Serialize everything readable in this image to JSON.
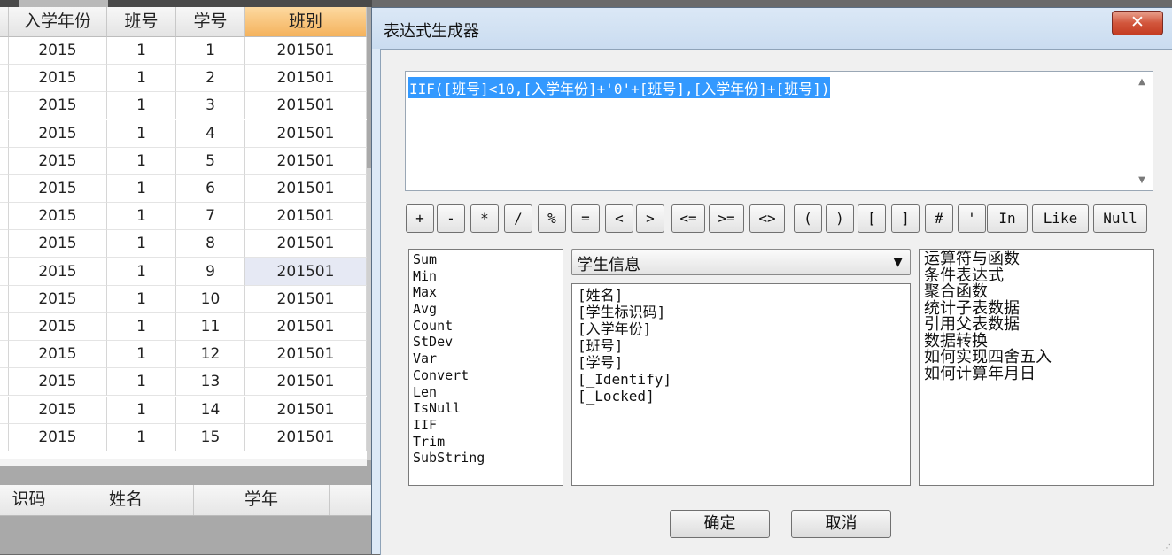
{
  "grid": {
    "columns": [
      "入学年份",
      "班号",
      "学号",
      "班别"
    ],
    "rows": [
      [
        "2015",
        "1",
        "1",
        "201501"
      ],
      [
        "2015",
        "1",
        "2",
        "201501"
      ],
      [
        "2015",
        "1",
        "3",
        "201501"
      ],
      [
        "2015",
        "1",
        "4",
        "201501"
      ],
      [
        "2015",
        "1",
        "5",
        "201501"
      ],
      [
        "2015",
        "1",
        "6",
        "201501"
      ],
      [
        "2015",
        "1",
        "7",
        "201501"
      ],
      [
        "2015",
        "1",
        "8",
        "201501"
      ],
      [
        "2015",
        "1",
        "9",
        "201501"
      ],
      [
        "2015",
        "1",
        "10",
        "201501"
      ],
      [
        "2015",
        "1",
        "11",
        "201501"
      ],
      [
        "2015",
        "1",
        "12",
        "201501"
      ],
      [
        "2015",
        "1",
        "13",
        "201501"
      ],
      [
        "2015",
        "1",
        "14",
        "201501"
      ],
      [
        "2015",
        "1",
        "15",
        "201501"
      ]
    ]
  },
  "sub_grid": {
    "columns": [
      "识码",
      "姓名",
      "学年"
    ]
  },
  "dialog": {
    "title": "表达式生成器",
    "close_label": "✕",
    "expression": "IIF([班号]<10,[入学年份]+'0'+[班号],[入学年份]+[班号])",
    "operators": [
      "+",
      "-",
      "*",
      "/",
      "%",
      "=",
      "<",
      ">",
      "<=",
      ">=",
      "<>",
      "(",
      ")",
      "[",
      "]",
      "#",
      "'",
      "In",
      "Like",
      "Null"
    ],
    "functions": [
      "Sum",
      "Min",
      "Max",
      "Avg",
      "Count",
      "StDev",
      "Var",
      "Convert",
      "Len",
      "IsNull",
      "IIF",
      "Trim",
      "SubString"
    ],
    "table_select": {
      "selected": "学生信息"
    },
    "fields": [
      "[姓名]",
      "[学生标识码]",
      "[入学年份]",
      "[班号]",
      "[学号]",
      "[_Identify]",
      "[_Locked]"
    ],
    "categories": [
      "运算符与函数",
      "条件表达式",
      "聚合函数",
      "统计子表数据",
      "引用父表数据",
      "数据转换",
      "如何实现四舍五入",
      "如何计算年月日"
    ],
    "ok_label": "确定",
    "cancel_label": "取消"
  },
  "colors": {
    "selection": "#3399ff",
    "active_header": "#f4b25c",
    "close_button": "#c43c22"
  }
}
